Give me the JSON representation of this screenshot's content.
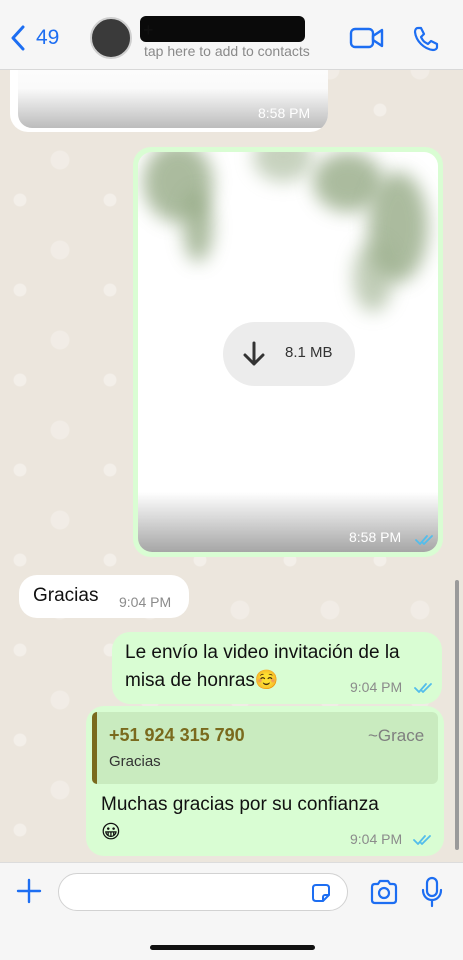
{
  "header": {
    "back_count": "49",
    "contact_prefix": "+",
    "contact_subtitle": "tap here to add to contacts"
  },
  "messages": [
    {
      "id": "img-top",
      "direction": "in",
      "time": "8:58 PM"
    },
    {
      "id": "video",
      "direction": "out",
      "file_size": "8.1 MB",
      "time": "8:58 PM",
      "status": "read"
    },
    {
      "id": "gracias",
      "direction": "in",
      "text": "Gracias",
      "time": "9:04 PM"
    },
    {
      "id": "invite",
      "direction": "out",
      "line1": "Le envío la video invitación de la",
      "line2": "misa de honras☺️",
      "time": "9:04 PM",
      "status": "read"
    },
    {
      "id": "reply",
      "direction": "out",
      "quote": {
        "phone": "+51 924 315 790",
        "author": "~Grace",
        "text": "Gracias"
      },
      "line1": "Muchas gracias por su confianza",
      "line2": "😀",
      "time": "9:04 PM",
      "status": "read"
    }
  ],
  "icons": {
    "back": "chevron-left-icon",
    "video_call": "video-camera-icon",
    "voice_call": "phone-icon",
    "download": "download-arrow-icon",
    "read": "double-check-icon",
    "attach": "plus-icon",
    "sticker": "sticker-icon",
    "camera": "camera-icon",
    "mic": "microphone-icon"
  },
  "colors": {
    "accent": "#1d6ef2",
    "outgoing_bubble": "#d9fdd3",
    "incoming_bubble": "#ffffff",
    "quote_name": "#7a6a1d",
    "read_tick": "#53bdeb"
  }
}
